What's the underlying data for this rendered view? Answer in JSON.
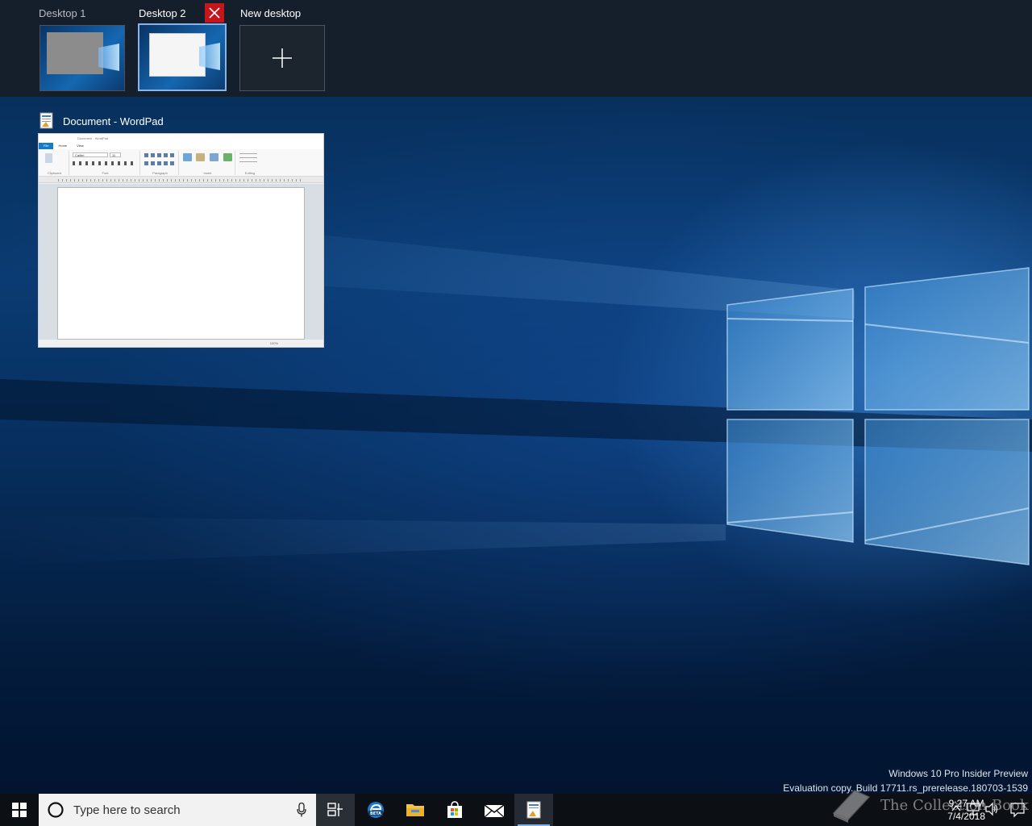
{
  "task_view": {
    "desktops": [
      {
        "label": "Desktop 1",
        "active": false
      },
      {
        "label": "Desktop 2",
        "active": true
      }
    ],
    "new_desktop_label": "New desktop"
  },
  "window": {
    "title": "Document - WordPad",
    "thumbnail": {
      "title_text": "Document - WordPad",
      "tabs": [
        "File",
        "Home",
        "View"
      ],
      "ribbon_groups": [
        "Clipboard",
        "Font",
        "Paragraph",
        "Insert",
        "Editing"
      ],
      "font_name": "Calibri",
      "font_size": "11",
      "zoom": "100%"
    }
  },
  "watermark": {
    "line1": "Windows 10 Pro Insider Preview",
    "line2": "Evaluation copy. Build 17711.rs_prerelease.180703-1539"
  },
  "taskbar": {
    "search_placeholder": "Type here to search",
    "pinned": [
      "edge-beta-icon",
      "file-explorer-icon",
      "store-icon",
      "mail-icon",
      "wordpad-icon"
    ],
    "clock_time": "9:27 AM",
    "clock_date": "7/4/2018",
    "overlay_text": "The Collection Book"
  },
  "colors": {
    "close_button": "#c4161c",
    "accent": "#1979ca",
    "active_border": "#8ab4e8"
  }
}
